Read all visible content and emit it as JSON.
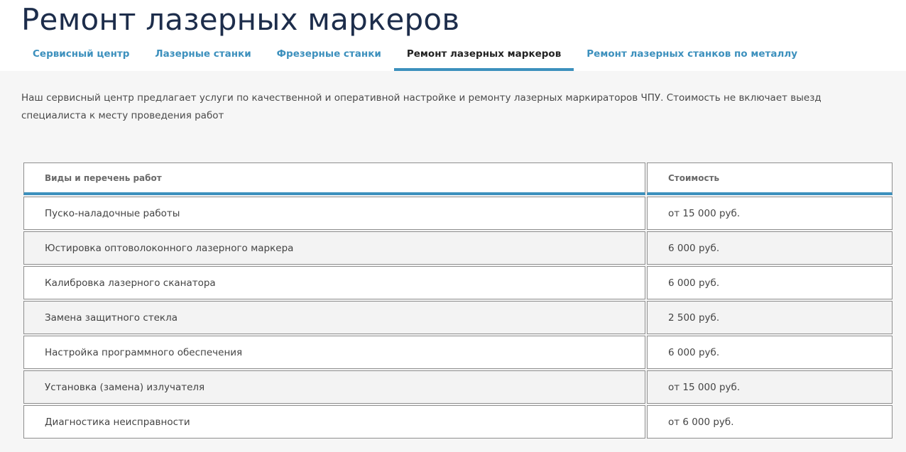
{
  "page": {
    "title": "Ремонт лазерных маркеров"
  },
  "tabs": [
    {
      "label": "Сервисный центр",
      "active": false
    },
    {
      "label": "Лазерные станки",
      "active": false
    },
    {
      "label": "Фрезерные станки",
      "active": false
    },
    {
      "label": "Ремонт лазерных маркеров",
      "active": true
    },
    {
      "label": "Ремонт лазерных станков по металлу",
      "active": false
    }
  ],
  "intro": "Наш сервисный центр предлагает услуги по качественной и оперативной настройке и ремонту лазерных маркираторов ЧПУ. Стоимость не включает выезд специалиста к месту проведения работ",
  "table": {
    "headers": [
      "Виды и перечень работ",
      "Стоимость"
    ],
    "rows": [
      {
        "work": "Пуско-наладочные работы",
        "price": "от 15 000 руб."
      },
      {
        "work": "Юстировка оптоволоконного лазерного маркера",
        "price": "6 000 руб."
      },
      {
        "work": "Калибровка лазерного сканатора",
        "price": "6 000 руб."
      },
      {
        "work": "Замена защитного стекла",
        "price": "2 500 руб."
      },
      {
        "work": "Настройка программного обеспечения",
        "price": "6 000 руб."
      },
      {
        "work": "Установка (замена)  излучателя",
        "price": "от 15 000 руб."
      },
      {
        "work": "Диагностика неисправности",
        "price": "от 6 000 руб."
      }
    ]
  },
  "colors": {
    "accent": "#3c90bd",
    "title": "#1d2d4b",
    "content_bg": "#f6f6f6"
  }
}
